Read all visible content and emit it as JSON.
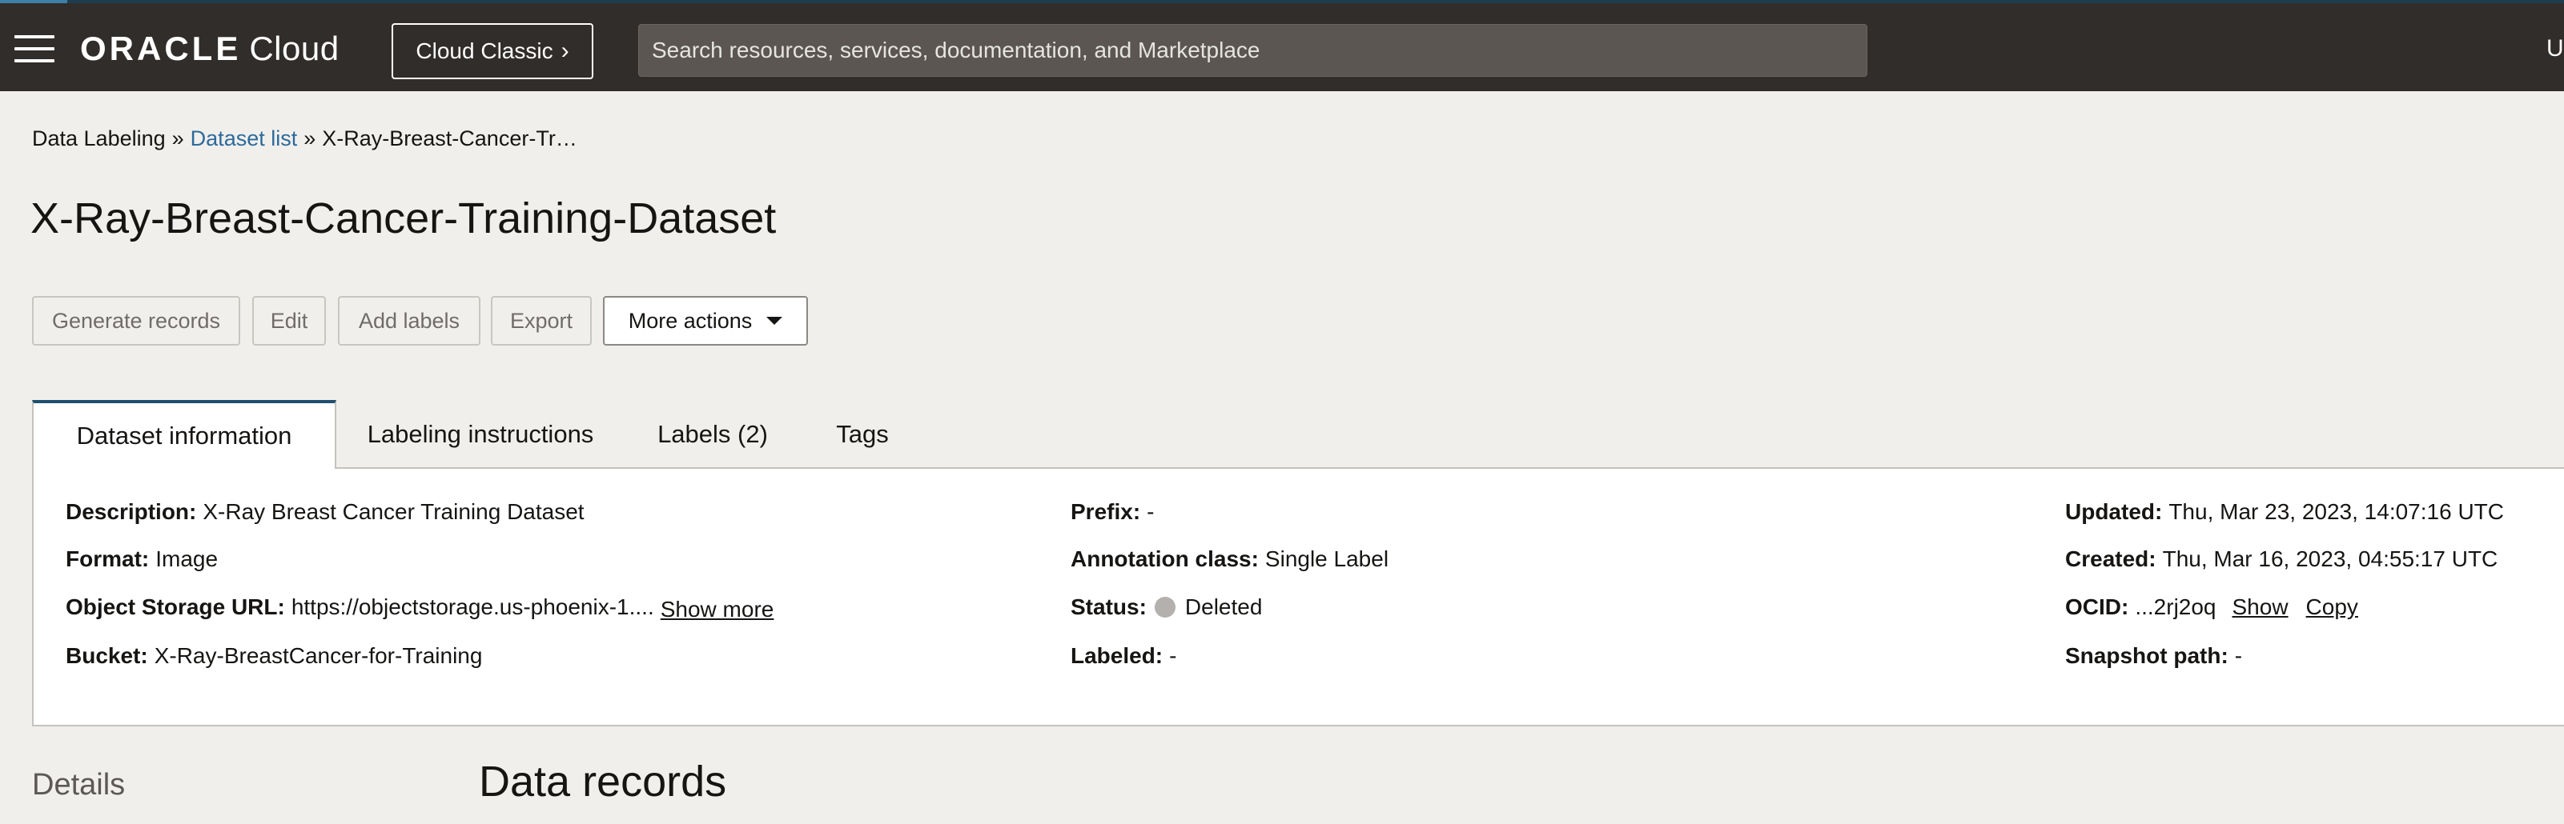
{
  "topbar": {
    "brand": "ORACLE",
    "product": "Cloud",
    "classic_button": "Cloud Classic",
    "search_placeholder": "Search resources, services, documentation, and Marketplace",
    "user_initial": "U"
  },
  "breadcrumb": {
    "root": "Data Labeling",
    "list": "Dataset list",
    "current": "X-Ray-Breast-Cancer-Tr…"
  },
  "page_title": "X-Ray-Breast-Cancer-Training-Dataset",
  "actions": {
    "generate": "Generate records",
    "edit": "Edit",
    "add_labels": "Add labels",
    "export": "Export",
    "more": "More actions"
  },
  "tabs": [
    {
      "label": "Dataset information",
      "active": true
    },
    {
      "label": "Labeling instructions",
      "active": false
    },
    {
      "label": "Labels (2)",
      "active": false
    },
    {
      "label": "Tags",
      "active": false
    }
  ],
  "info": {
    "description_label": "Description:",
    "description_value": "X-Ray Breast Cancer Training Dataset",
    "format_label": "Format:",
    "format_value": "Image",
    "url_label": "Object Storage URL:",
    "url_value": "https://objectstorage.us-phoenix-1....",
    "url_show_more": "Show more",
    "bucket_label": "Bucket:",
    "bucket_value": "X-Ray-BreastCancer-for-Training",
    "prefix_label": "Prefix:",
    "prefix_value": "-",
    "annotation_label": "Annotation class:",
    "annotation_value": "Single Label",
    "status_label": "Status:",
    "status_value": "Deleted",
    "status_color": "#b3b0ad",
    "labeled_label": "Labeled:",
    "labeled_value": "-",
    "updated_label": "Updated:",
    "updated_value": "Thu, Mar 23, 2023, 14:07:16 UTC",
    "created_label": "Created:",
    "created_value": "Thu, Mar 16, 2023, 04:55:17 UTC",
    "ocid_label": "OCID:",
    "ocid_value": "...2rj2oq",
    "ocid_show": "Show",
    "ocid_copy": "Copy",
    "snapshot_label": "Snapshot path:",
    "snapshot_value": "-"
  },
  "bottom": {
    "details": "Details",
    "records_title": "Data records"
  },
  "colors": {
    "topbar_bg": "#312d2a",
    "link": "#2b6a9c",
    "page_bg": "#f1efec",
    "active_tab_accent": "#1f4f6f"
  }
}
